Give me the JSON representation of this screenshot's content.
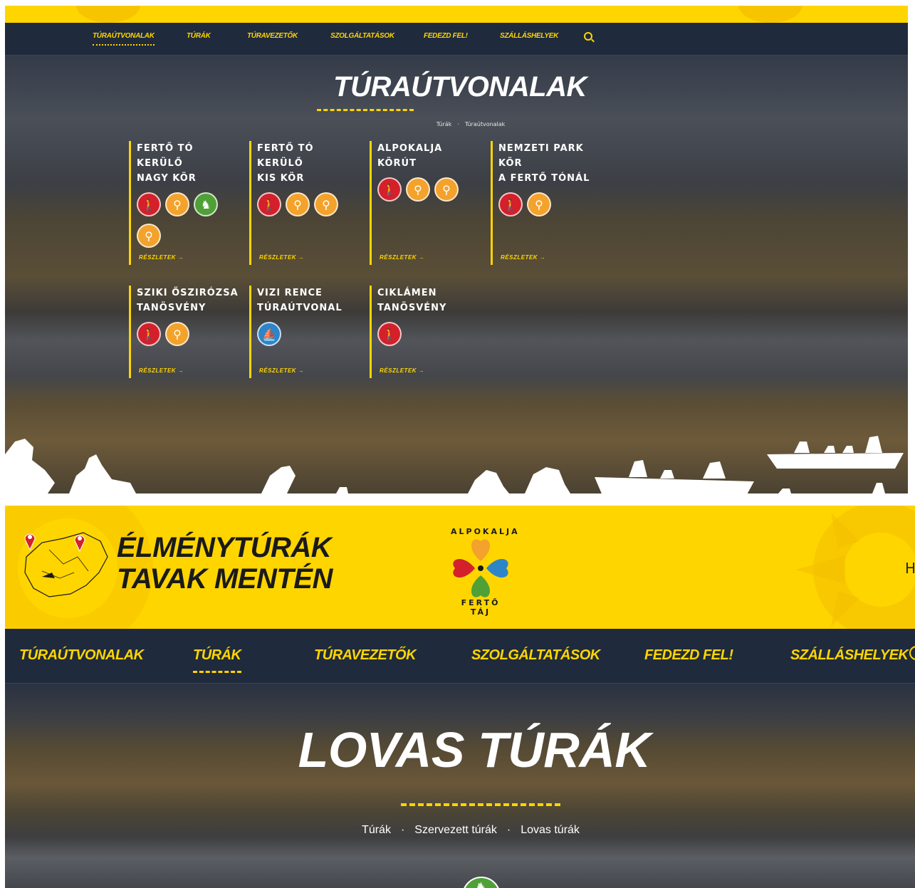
{
  "panel1": {
    "nav": {
      "items": [
        "TÚRAÚTVONALAK",
        "TÚRÁK",
        "TÚRAVEZETŐK",
        "SZOLGÁLTATÁSOK",
        "FEDEZD FEL!",
        "SZÁLLÁSHELYEK"
      ],
      "active": "TÚRAÚTVONALAK",
      "search_icon": "search-icon"
    },
    "page_title": "TÚRAÚTVONALAK",
    "breadcrumb": [
      "Túrák",
      "Túraútvonalak"
    ],
    "breadcrumb_sep": "·",
    "more_label": "RÉSZLETEK →",
    "cards": [
      {
        "title_line1": "FERTŐ TÓ KERÜLŐ",
        "title_line2": "NAGY KÖR",
        "icons": [
          "hiker-icon",
          "bike-icon",
          "horse-icon",
          "bike-icon"
        ]
      },
      {
        "title_line1": "FERTŐ TÓ KERÜLŐ",
        "title_line2": "KIS KÖR",
        "icons": [
          "hiker-icon",
          "bike-icon",
          "bike-icon"
        ]
      },
      {
        "title_line1": "ALPOKALJA KÖRÚT",
        "title_line2": "",
        "icons": [
          "hiker-icon",
          "bike-icon",
          "bike-icon"
        ]
      },
      {
        "title_line1": "NEMZETI PARK KÖR",
        "title_line2": "A FERTŐ TÓNÁL",
        "icons": [
          "hiker-icon",
          "bike-icon"
        ]
      },
      {
        "title_line1": "SZIKI ŐSZIRÓZSA",
        "title_line2": "TANÖSVÉNY",
        "icons": [
          "hiker-icon",
          "bike-icon"
        ]
      },
      {
        "title_line1": "VIZI RENCE",
        "title_line2": "TÚRAÚTVONAL",
        "icons": [
          "boat-icon"
        ]
      },
      {
        "title_line1": "CIKLÁMEN",
        "title_line2": "TANÖSVÉNY",
        "icons": [
          "hiker-icon"
        ]
      }
    ]
  },
  "panel2": {
    "logo_line1": "ÉLMÉNYTÚRÁK",
    "logo_line2": "TAVAK MENTÉN",
    "center_logo_top": "ALPOKALJA",
    "center_logo_bottom": "FERTŐ TÁJ",
    "header_partial_text": "H",
    "nav": {
      "items": [
        "TÚRAÚTVONALAK",
        "TÚRÁK",
        "TÚRAVEZETŐK",
        "SZOLGÁLTATÁSOK",
        "FEDEZD FEL!",
        "SZÁLLÁSHELYEK"
      ],
      "active": "TÚRÁK",
      "search_icon": "search-icon"
    },
    "page_title": "LOVAS TÚRÁK",
    "breadcrumb": [
      "Túrák",
      "Szervezett túrák",
      "Lovas túrák"
    ],
    "breadcrumb_sep": "·",
    "bottom_icon": "horse-icon"
  },
  "colors": {
    "brand_yellow": "#ffd500",
    "nav_navy": "#1f2a3c",
    "hiker": "#d3202a",
    "bike": "#f3a22c",
    "horse": "#4fa036",
    "boat": "#2d85c8"
  }
}
